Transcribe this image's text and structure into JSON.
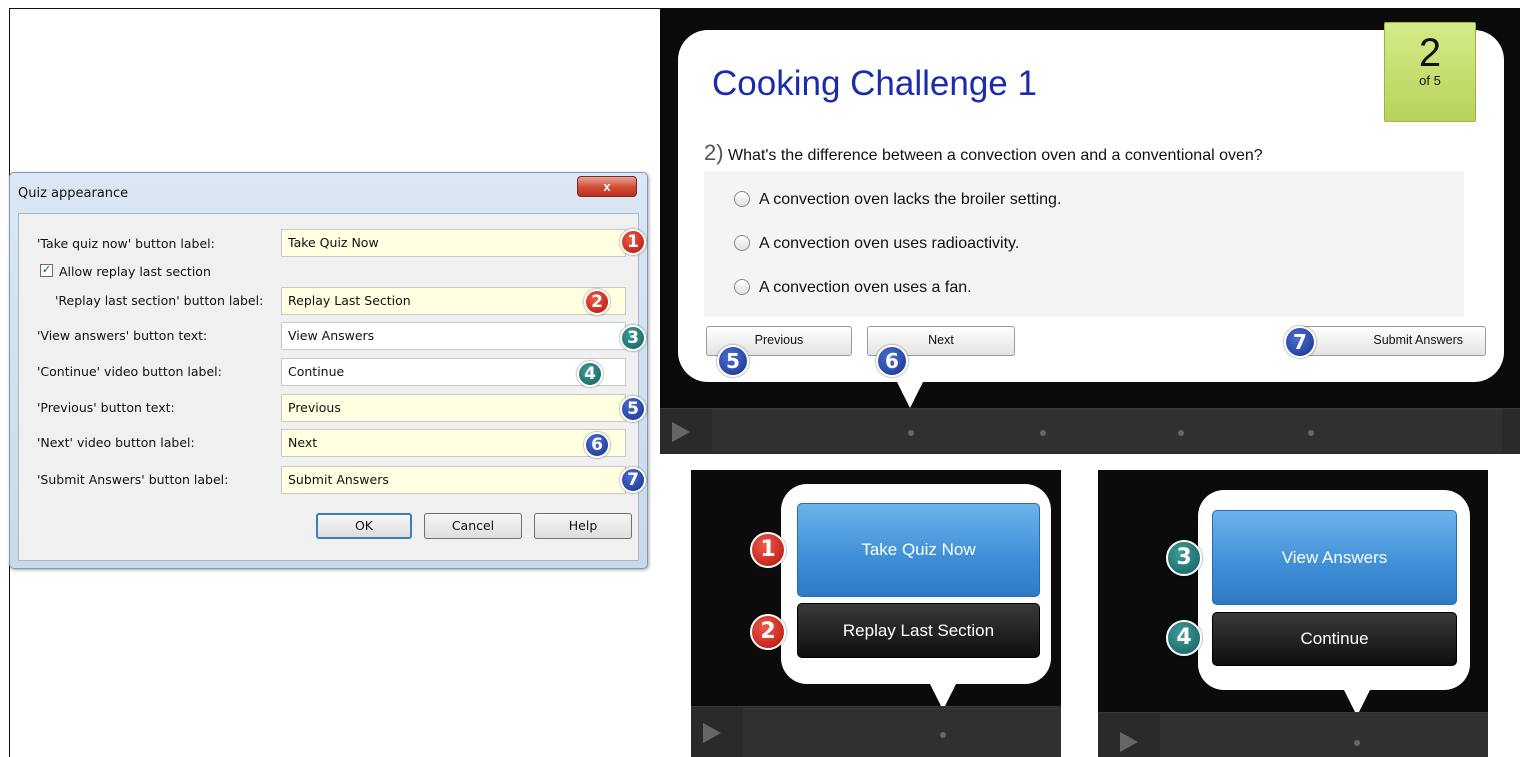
{
  "dialog": {
    "title": "Quiz appearance",
    "close_label": "x",
    "rows": [
      {
        "label": "'Take quiz now' button label:",
        "value": "Take Quiz Now",
        "marker": "1"
      },
      {
        "label": "'Replay last section' button label:",
        "value": "Replay Last Section",
        "marker": "2"
      },
      {
        "label": "'View answers' button text:",
        "value": "View Answers",
        "marker": "3"
      },
      {
        "label": "'Continue' video button label:",
        "value": "Continue",
        "marker": "4"
      },
      {
        "label": "'Previous' button text:",
        "value": "Previous",
        "marker": "5"
      },
      {
        "label": "'Next' video button label:",
        "value": "Next",
        "marker": "6"
      },
      {
        "label": "'Submit Answers' button label:",
        "value": "Submit Answers",
        "marker": "7"
      }
    ],
    "allow_replay_label": "Allow replay last section",
    "allow_replay_checked": true,
    "ok_label": "OK",
    "cancel_label": "Cancel",
    "help_label": "Help"
  },
  "quiz": {
    "title": "Cooking Challenge 1",
    "count_current": "2",
    "count_total": "of 5",
    "question_number": "2)",
    "question_text": "What's the difference between a convection oven and a conventional oven?",
    "answers": [
      "A convection oven lacks the broiler setting.",
      "A convection oven uses radioactivity.",
      "A convection oven uses a fan."
    ],
    "previous_label": "Previous",
    "next_label": "Next",
    "submit_label": "Submit Answers"
  },
  "intro_panel": {
    "take_quiz_label": "Take Quiz Now",
    "replay_label": "Replay Last Section"
  },
  "answers_panel": {
    "view_answers_label": "View Answers",
    "continue_label": "Continue"
  },
  "markers": {
    "m1": "1",
    "m2": "2",
    "m3": "3",
    "m4": "4",
    "m5": "5",
    "m6": "6",
    "m7": "7"
  },
  "colors": {
    "marker_red": "#b3130b",
    "marker_teal": "#14605d",
    "marker_blue": "#17318e",
    "quiz_title": "#1a2ca8",
    "count_box": "#c6e06e",
    "blue_button": "#3e8ed6"
  }
}
